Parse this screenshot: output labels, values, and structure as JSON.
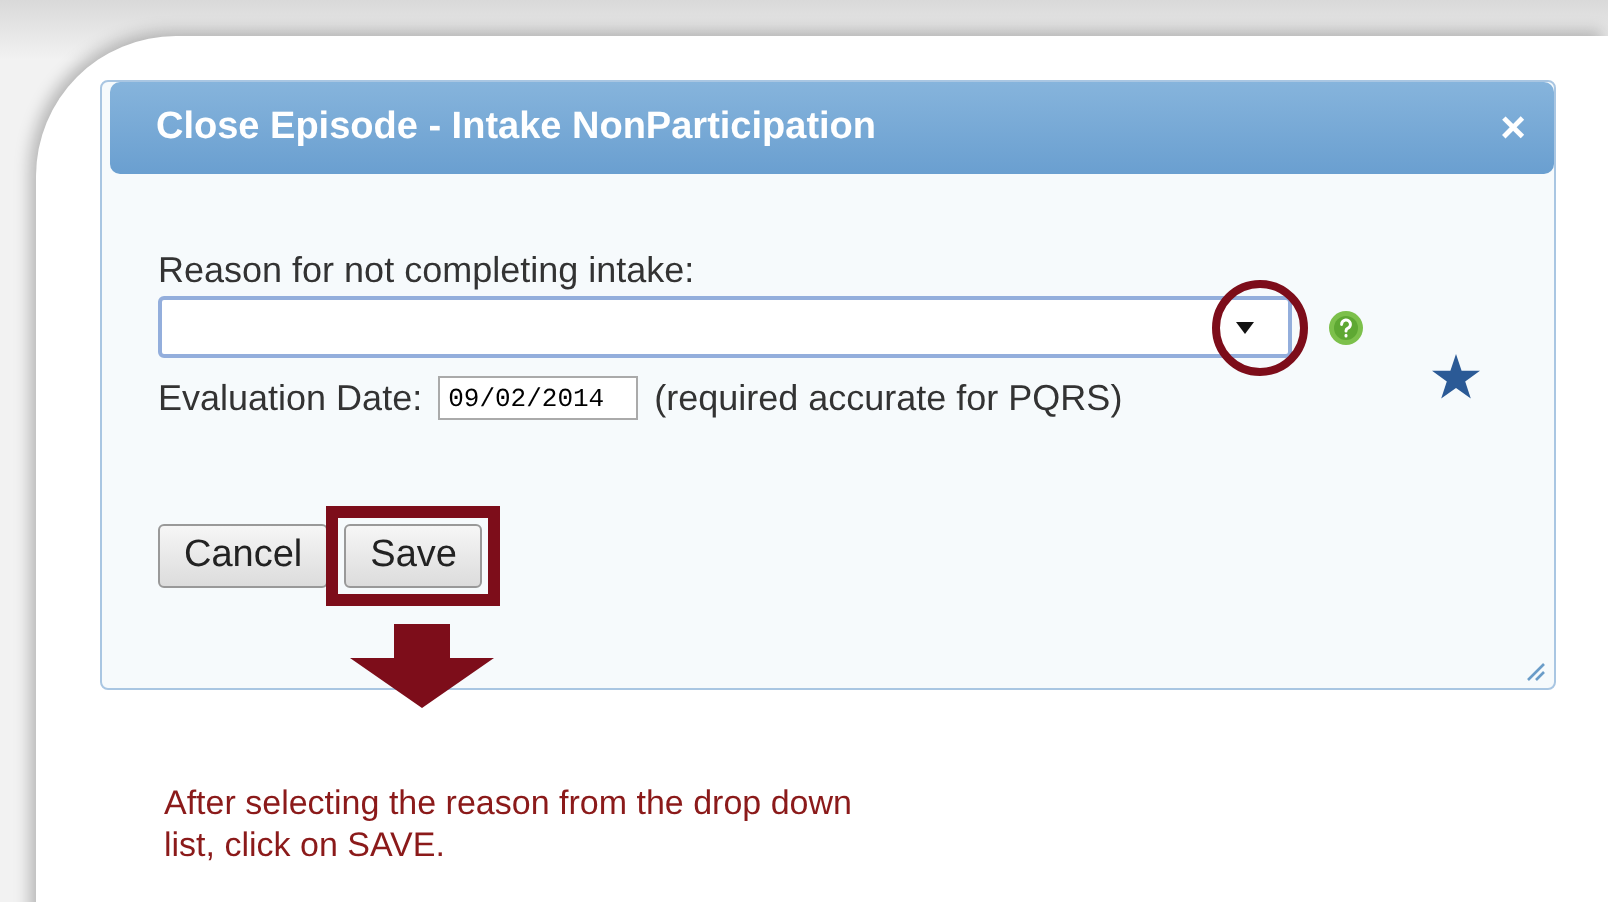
{
  "dialog": {
    "title": "Close Episode - Intake NonParticipation",
    "close_symbol": "×",
    "reason": {
      "label": "Reason for not completing intake:"
    },
    "evaluation_date": {
      "label": "Evaluation Date:",
      "value": "09/02/2014",
      "note": "(required accurate for PQRS)"
    },
    "buttons": [
      {
        "label": "Cancel",
        "highlighted": false
      },
      {
        "label": "Save",
        "highlighted": true
      }
    ]
  },
  "instruction": "After selecting the reason from the drop down list, click on SAVE."
}
